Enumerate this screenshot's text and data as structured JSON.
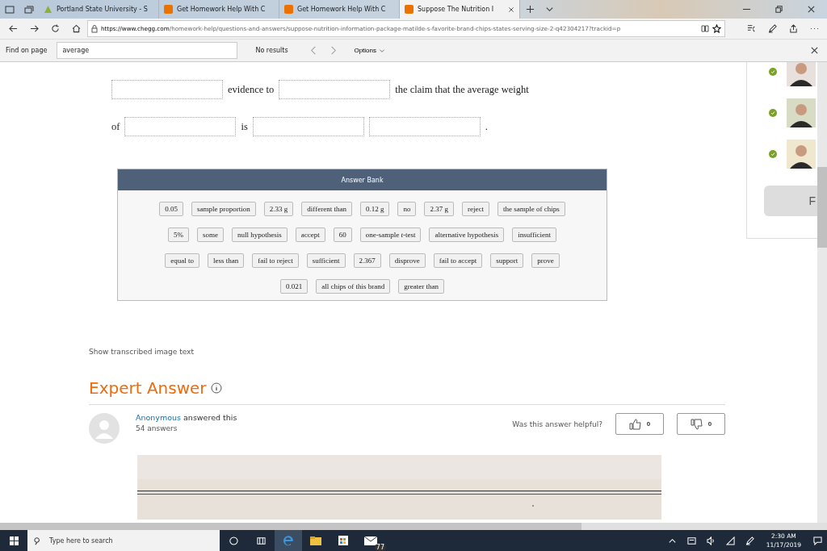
{
  "tabs": [
    {
      "title": "Portland State University - S",
      "selected": false
    },
    {
      "title": "Get Homework Help With C",
      "selected": false
    },
    {
      "title": "Get Homework Help With C",
      "selected": false
    },
    {
      "title": "Suppose The Nutrition I",
      "selected": true
    }
  ],
  "address": {
    "url_host": "https://www.chegg.com",
    "url_path": "/homework-help/questions-and-answers/suppose-nutrition-information-package-matilde-s-favorite-brand-chips-states-serving-size-2-q42304217?trackid=p"
  },
  "find_bar": {
    "label": "Find on page",
    "value": "average",
    "result": "No results",
    "options": "Options"
  },
  "question": {
    "rows": [
      [
        {
          "kind": "blank"
        },
        {
          "kind": "text",
          "text": "evidence to"
        },
        {
          "kind": "blank"
        },
        {
          "kind": "text",
          "text": "the claim that the average weight"
        }
      ],
      [
        {
          "kind": "text",
          "text": "of"
        },
        {
          "kind": "blank"
        },
        {
          "kind": "text",
          "text": "is"
        },
        {
          "kind": "blank"
        },
        {
          "kind": "blank"
        },
        {
          "kind": "text",
          "text": "."
        }
      ]
    ]
  },
  "answer_bank": {
    "title": "Answer Bank",
    "rows": [
      {
        "chips": [
          "0.05",
          "sample proportion",
          "2.33 g",
          "different than",
          "0.12 g",
          "no",
          "2.37 g",
          "reject",
          "the sample of chips"
        ]
      },
      {
        "chips": [
          "5%",
          "some",
          "null hypothesis",
          "accept",
          "60",
          "one-sample *t*-test",
          "alternative hypothesis",
          "insufficient"
        ]
      },
      {
        "chips": [
          "equal to",
          "less than",
          "fail to reject",
          "sufficient",
          "2.367",
          "disprove",
          "fail to accept",
          "support",
          "prove"
        ]
      },
      {
        "chips": [
          "0.021",
          "all chips of this brand",
          "greater than"
        ]
      }
    ]
  },
  "show_transcribed": "Show transcribed image text",
  "expert_answer": {
    "title": "Expert Answer",
    "author": "Anonymous",
    "answered": "answered this",
    "count": "54 answers",
    "helpful": "Was this answer helpful?",
    "thumbs_up": "0",
    "thumbs_down": "0"
  },
  "experts": [
    {
      "verified": true
    },
    {
      "verified": true
    },
    {
      "verified": true
    }
  ],
  "side_button": "F",
  "taskbar": {
    "search": "Type here to search",
    "mail_badge": "77",
    "time": "2:30 AM",
    "date": "11/17/2019"
  }
}
